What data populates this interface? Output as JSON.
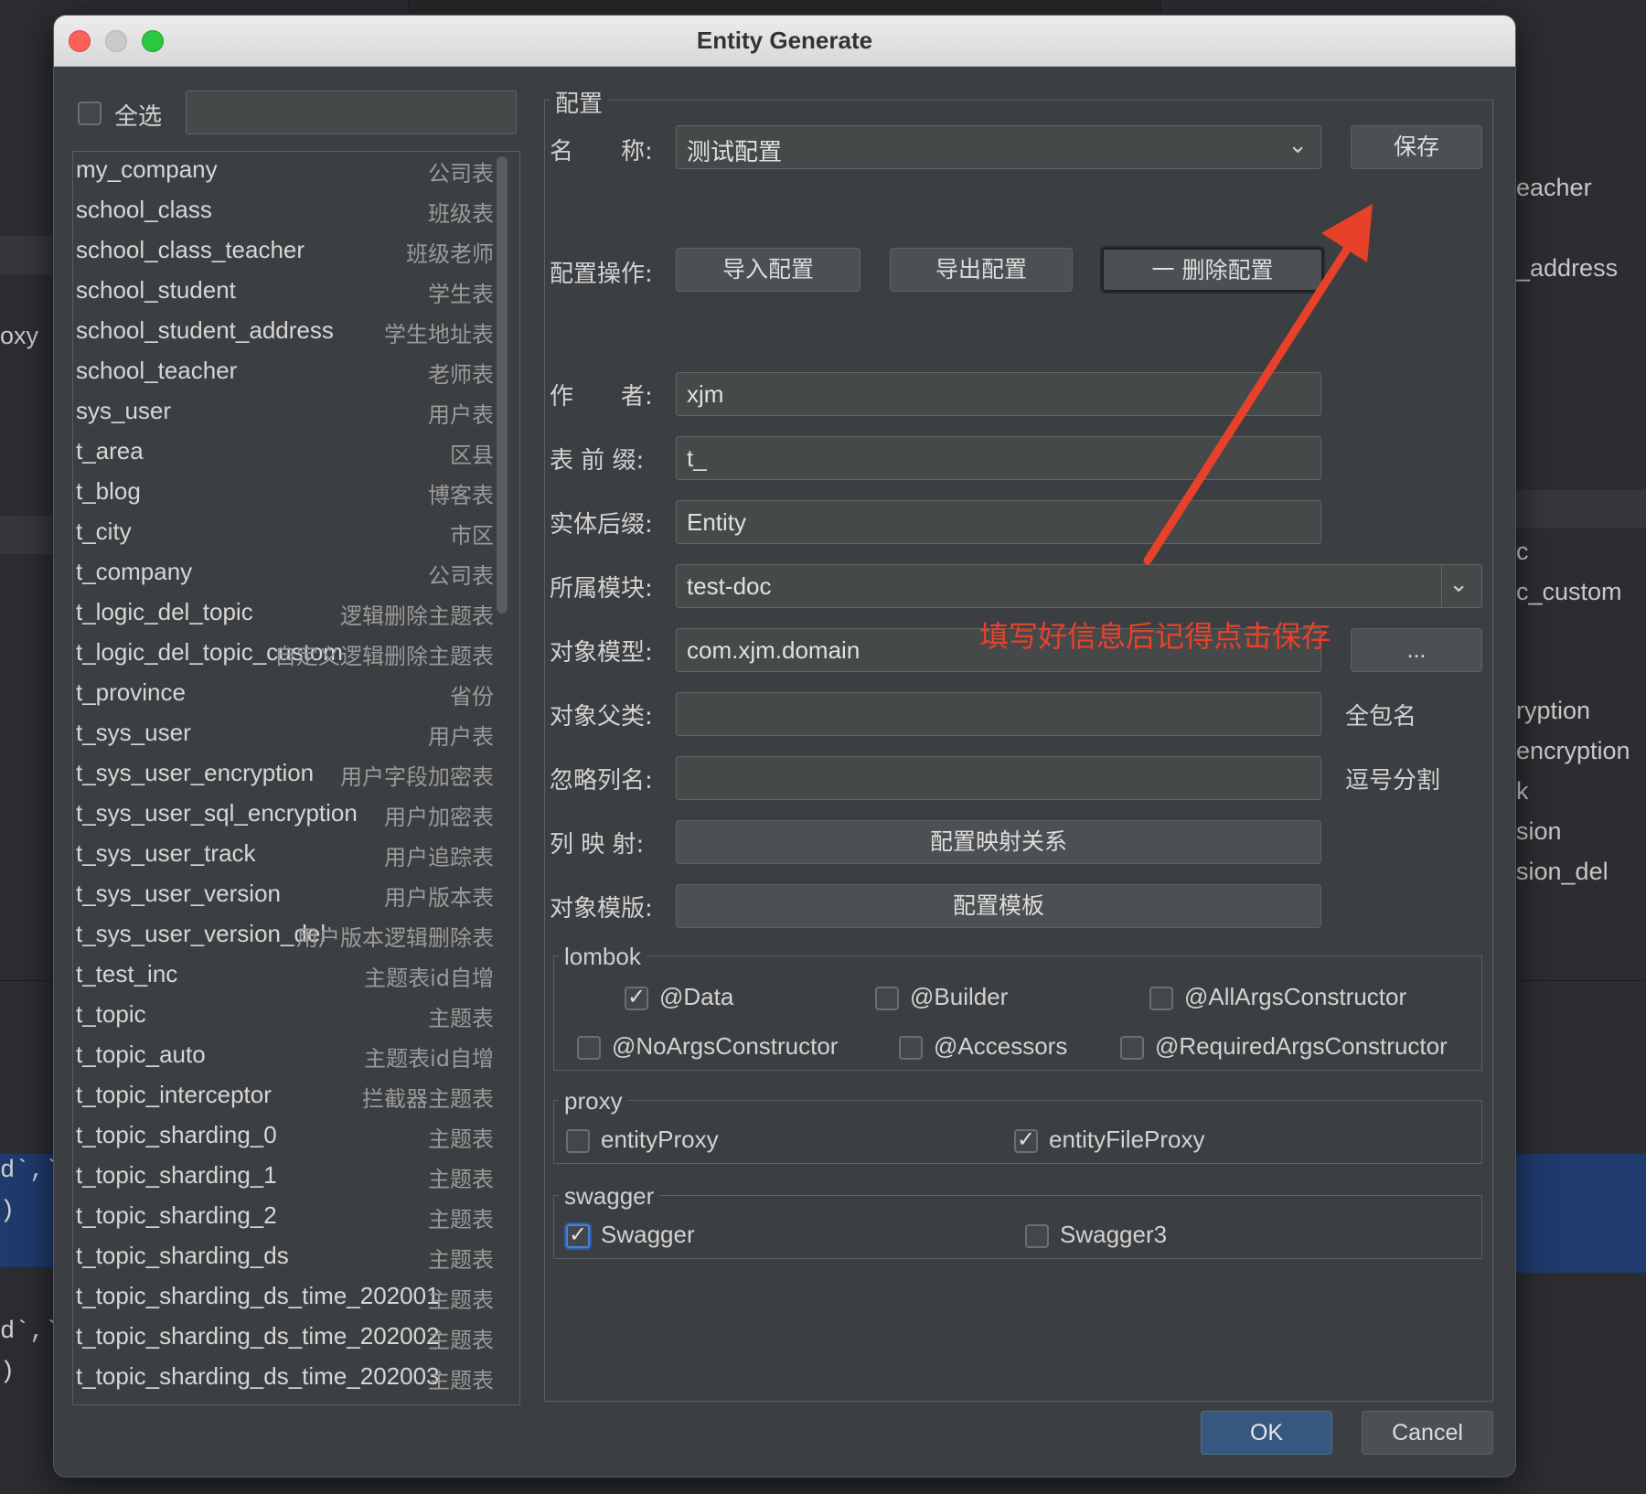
{
  "window": {
    "title": "Entity Generate"
  },
  "background": {
    "right_items": [
      "eacher",
      "_address",
      "c",
      "c_custom",
      "ryption",
      "encryption",
      "k",
      "sion",
      "sion_del"
    ],
    "left_items": [
      "oxy"
    ],
    "code": [
      "d`,`",
      ")",
      "d`,`",
      ")"
    ]
  },
  "left": {
    "select_all_label": "全选",
    "search_value": "",
    "tables": [
      {
        "name": "my_company",
        "comment": "公司表"
      },
      {
        "name": "school_class",
        "comment": "班级表"
      },
      {
        "name": "school_class_teacher",
        "comment": "班级老师"
      },
      {
        "name": "school_student",
        "comment": "学生表"
      },
      {
        "name": "school_student_address",
        "comment": "学生地址表"
      },
      {
        "name": "school_teacher",
        "comment": "老师表"
      },
      {
        "name": "sys_user",
        "comment": "用户表"
      },
      {
        "name": "t_area",
        "comment": "区县"
      },
      {
        "name": "t_blog",
        "comment": "博客表"
      },
      {
        "name": "t_city",
        "comment": "市区"
      },
      {
        "name": "t_company",
        "comment": "公司表"
      },
      {
        "name": "t_logic_del_topic",
        "comment": "逻辑删除主题表"
      },
      {
        "name": "t_logic_del_topic_custom",
        "comment": "自定义逻辑删除主题表"
      },
      {
        "name": "t_province",
        "comment": "省份"
      },
      {
        "name": "t_sys_user",
        "comment": "用户表"
      },
      {
        "name": "t_sys_user_encryption",
        "comment": "用户字段加密表"
      },
      {
        "name": "t_sys_user_sql_encryption",
        "comment": "用户加密表"
      },
      {
        "name": "t_sys_user_track",
        "comment": "用户追踪表"
      },
      {
        "name": "t_sys_user_version",
        "comment": "用户版本表"
      },
      {
        "name": "t_sys_user_version_del",
        "comment": "用户版本逻辑删除表"
      },
      {
        "name": "t_test_inc",
        "comment": "主题表id自增"
      },
      {
        "name": "t_topic",
        "comment": "主题表"
      },
      {
        "name": "t_topic_auto",
        "comment": "主题表id自增"
      },
      {
        "name": "t_topic_interceptor",
        "comment": "拦截器主题表"
      },
      {
        "name": "t_topic_sharding_0",
        "comment": "主题表"
      },
      {
        "name": "t_topic_sharding_1",
        "comment": "主题表"
      },
      {
        "name": "t_topic_sharding_2",
        "comment": "主题表"
      },
      {
        "name": "t_topic_sharding_ds",
        "comment": "主题表"
      },
      {
        "name": "t_topic_sharding_ds_time_202001",
        "comment": "主题表"
      },
      {
        "name": "t_topic_sharding_ds_time_202002",
        "comment": "主题表"
      },
      {
        "name": "t_topic_sharding_ds_time_202003",
        "comment": "主题表"
      }
    ]
  },
  "config": {
    "group_title": "配置",
    "name_label": "名　　称:",
    "name_value": "测试配置",
    "save_label": "保存",
    "ops_label": "配置操作:",
    "import_label": "导入配置",
    "export_label": "导出配置",
    "delete_label": "一 删除配置",
    "author_label": "作　　者:",
    "author_value": "xjm",
    "prefix_label": "表 前 缀:",
    "prefix_value": "t_",
    "suffix_label": "实体后缀:",
    "suffix_value": "Entity",
    "module_label": "所属模块:",
    "module_value": "test-doc",
    "model_label": "对象模型:",
    "model_value": "com.xjm.domain",
    "model_browse": "...",
    "parent_label": "对象父类:",
    "parent_value": "",
    "parent_hint": "全包名",
    "ignore_label": "忽略列名:",
    "ignore_value": "",
    "ignore_hint": "逗号分割",
    "mapping_label": "列 映 射:",
    "mapping_button": "配置映射关系",
    "template_label": "对象模版:",
    "template_button": "配置模板"
  },
  "lombok": {
    "title": "lombok",
    "data": "@Data",
    "builder": "@Builder",
    "all_args": "@AllArgsConstructor",
    "no_args": "@NoArgsConstructor",
    "accessors": "@Accessors",
    "required_args": "@RequiredArgsConstructor"
  },
  "proxy": {
    "title": "proxy",
    "entity_proxy": "entityProxy",
    "entity_file_proxy": "entityFileProxy"
  },
  "swagger": {
    "title": "swagger",
    "swagger": "Swagger",
    "swagger3": "Swagger3"
  },
  "annotation": {
    "text": "填写好信息后记得点击保存",
    "color": "#e8412a"
  },
  "footer": {
    "ok": "OK",
    "cancel": "Cancel"
  },
  "colors": {
    "dialog_bg": "#3c3f41",
    "primary": "#365880"
  }
}
